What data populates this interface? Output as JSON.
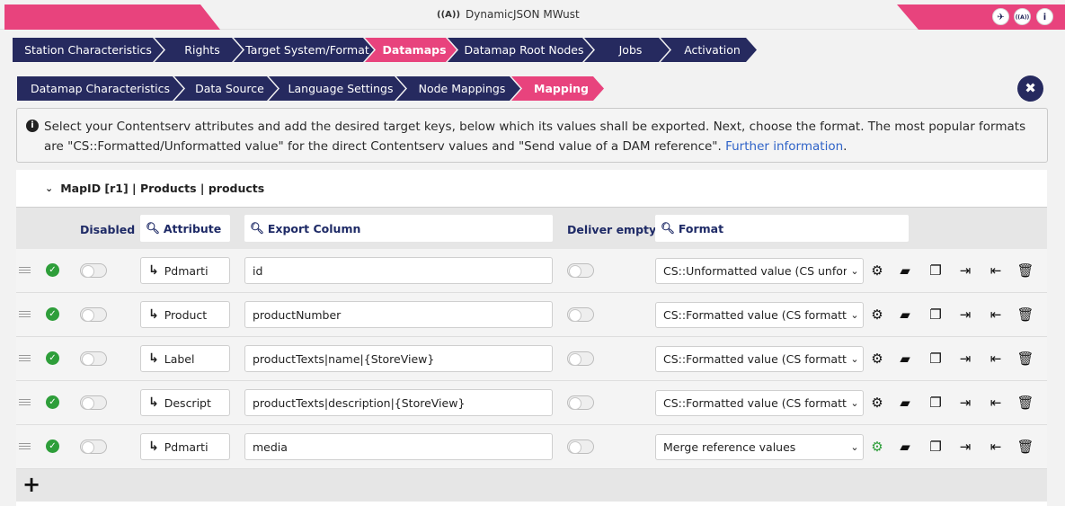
{
  "window": {
    "title": "DynamicJSON MWust",
    "title_icon": "broadcast-icon",
    "buttons": [
      {
        "name": "plane-icon",
        "glyph": "✈"
      },
      {
        "name": "broadcast-icon",
        "glyph": "((A))"
      },
      {
        "name": "info-icon",
        "glyph": "i"
      }
    ]
  },
  "main_tabs": [
    {
      "label": "Station Characteristics",
      "active": false
    },
    {
      "label": "Rights",
      "active": false
    },
    {
      "label": "Target System/Format",
      "active": false
    },
    {
      "label": "Datamaps",
      "active": true
    },
    {
      "label": "Datamap Root Nodes",
      "active": false
    },
    {
      "label": "Jobs",
      "active": false
    },
    {
      "label": "Activation",
      "active": false
    }
  ],
  "sub_tabs": [
    {
      "label": "Datamap Characteristics",
      "active": false
    },
    {
      "label": "Data Source",
      "active": false
    },
    {
      "label": "Language Settings",
      "active": false
    },
    {
      "label": "Node Mappings",
      "active": false
    },
    {
      "label": "Mapping",
      "active": true
    }
  ],
  "close_glyph": "✖",
  "info": {
    "text": "Select your Contentserv attributes and add the desired target keys, below which its values shall be exported. Next, choose the format. The most popular formats are \"CS::Formatted/Unformatted value\" for the direct Contentserv values and \"Send value of a DAM reference\". ",
    "link": "Further information",
    "suffix": "."
  },
  "mapping": {
    "header": "MapID [r1] | Products | products",
    "columns": {
      "disabled": "Disabled",
      "attribute": "Attribute",
      "export_column": "Export Column",
      "deliver_empty": "Deliver empty",
      "format": "Format"
    },
    "rows": [
      {
        "attribute": "Pdmarti",
        "export_column": "id",
        "format": "CS::Unformatted value (CS unformatted)",
        "settings_active": false
      },
      {
        "attribute": "Product",
        "export_column": "productNumber",
        "format": "CS::Formatted value (CS formatted)",
        "settings_active": false
      },
      {
        "attribute": "Label",
        "export_column": "productTexts|name|{StoreView}",
        "format": "CS::Formatted value (CS formatted)",
        "settings_active": false
      },
      {
        "attribute": "Descript",
        "export_column": "productTexts|description|{StoreView}",
        "format": "CS::Formatted value (CS formatted)",
        "settings_active": false
      },
      {
        "attribute": "Pdmarti",
        "export_column": "media",
        "format": "Merge reference values",
        "settings_active": true
      }
    ],
    "add_glyph": "+"
  }
}
